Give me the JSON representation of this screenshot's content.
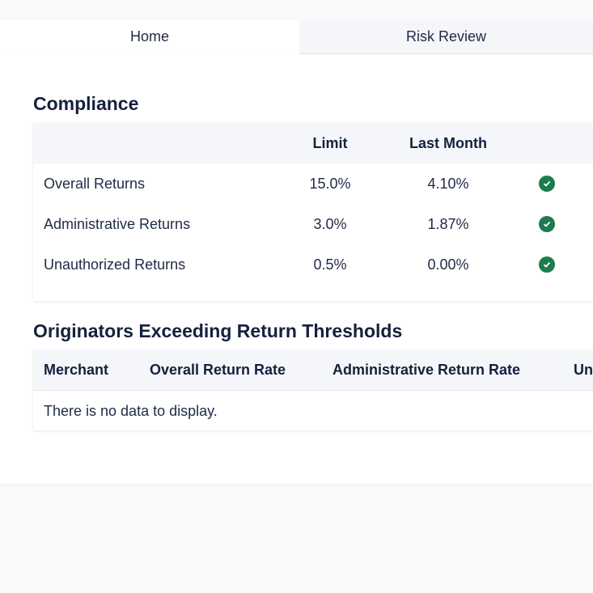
{
  "tabs": [
    {
      "label": "Home",
      "active": true
    },
    {
      "label": "Risk Review",
      "active": false
    }
  ],
  "compliance": {
    "title": "Compliance",
    "headers": [
      "",
      "Limit",
      "Last Month",
      ""
    ],
    "rows": [
      {
        "label": "Overall Returns",
        "limit": "15.0%",
        "last_month": "4.10%",
        "status": "check-circle-icon"
      },
      {
        "label": "Administrative Returns",
        "limit": "3.0%",
        "last_month": "1.87%",
        "status": "check-circle-icon"
      },
      {
        "label": "Unauthorized Returns",
        "limit": "0.5%",
        "last_month": "0.00%",
        "status": "check-circle-icon"
      }
    ],
    "status_color": "#1e7b4f"
  },
  "originators": {
    "title": "Originators Exceeding Return Thresholds",
    "headers": [
      "Merchant",
      "Overall Return Rate",
      "Administrative Return Rate",
      "Un"
    ],
    "empty_message": "There is no data to display."
  }
}
